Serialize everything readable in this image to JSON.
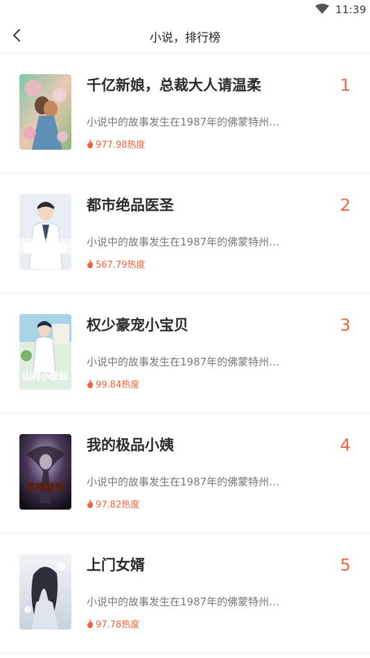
{
  "status_bar": {
    "time": "11:39",
    "wifi_icon": "wifi-icon"
  },
  "nav": {
    "title": "小说，排行榜",
    "back_icon": "chevron-left-icon"
  },
  "colors": {
    "accent": "#f2623d",
    "title_text": "#2a2a2a",
    "desc_text": "#777777"
  },
  "items": [
    {
      "rank": "1",
      "title": "千亿新娘，总裁大人请温柔",
      "desc": "小说中的故事发生在1987年的佛蒙特州…",
      "heat": "977.98热度"
    },
    {
      "rank": "2",
      "title": "都市绝品医圣",
      "desc": "小说中的故事发生在1987年的佛蒙特州…",
      "heat": "567.79热度",
      "cover_text": "都市医圣"
    },
    {
      "rank": "3",
      "title": "权少豪宠小宝贝",
      "desc": "小说中的故事发生在1987年的佛蒙特州…",
      "heat": "99.84热度",
      "cover_text": "山村小医仙"
    },
    {
      "rank": "4",
      "title": "我的极品小姨",
      "desc": "小说中的故事发生在1987年的佛蒙特州…",
      "heat": "97.82热度",
      "cover_text": "武神破世"
    },
    {
      "rank": "5",
      "title": "上门女婿",
      "desc": "小说中的故事发生在1987年的佛蒙特州…",
      "heat": "97.78热度"
    }
  ]
}
